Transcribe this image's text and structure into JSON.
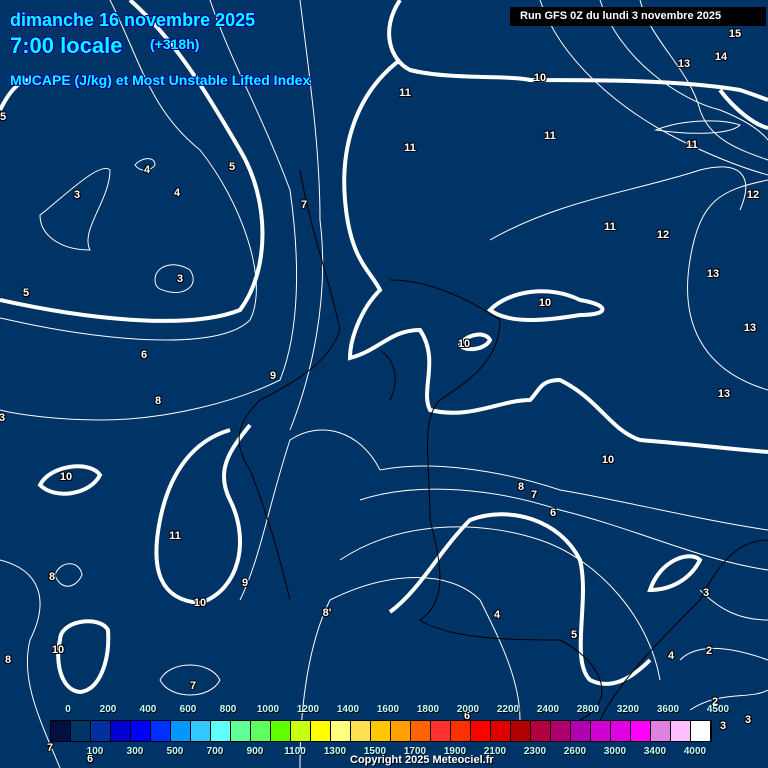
{
  "header": {
    "date": "dimanche 16 novembre 2025",
    "hour": "7:00 locale",
    "lead": "(+318h)",
    "parameter": "MUCAPE (J/kg) et Most Unstable Lifted Index",
    "run": "Run GFS 0Z du lundi 3 novembre 2025"
  },
  "contour_labels": [
    "11",
    "10",
    "15",
    "14",
    "13",
    "11",
    "11",
    "11",
    "5",
    "4",
    "4",
    "5",
    "3",
    "7",
    "12",
    "11",
    "12",
    "3",
    "5",
    "13",
    "10",
    "13",
    "10",
    "6",
    "9",
    "8",
    "3",
    "13",
    "10",
    "10",
    "8",
    "7",
    "6",
    "11",
    "8",
    "9",
    "10",
    "8'",
    "4",
    "3",
    "5",
    "10",
    "8",
    "4",
    "2",
    "7",
    "2",
    "3",
    "3",
    "6",
    "7",
    "6"
  ],
  "legend": {
    "colors": [
      "#001040",
      "#003366",
      "#0030a0",
      "#0000d0",
      "#0000ff",
      "#0030ff",
      "#0098ff",
      "#30c8ff",
      "#60ffff",
      "#60ff98",
      "#60ff60",
      "#60ff00",
      "#c8ff10",
      "#ffff00",
      "#ffff80",
      "#ffe050",
      "#ffc800",
      "#ffa000",
      "#ff6400",
      "#ff3030",
      "#ff3000",
      "#ff0000",
      "#e00000",
      "#b00000",
      "#b00040",
      "#b00070",
      "#b000b0",
      "#d000d0",
      "#e000e0",
      "#ff00ff",
      "#e080e0",
      "#ffc0ff",
      "#ffffff"
    ],
    "top_labels": [
      "0",
      "200",
      "400",
      "600",
      "800",
      "1000",
      "1200",
      "1400",
      "1600",
      "1800",
      "2000",
      "2200",
      "2400",
      "2800",
      "3200",
      "3600",
      "4500"
    ],
    "bottom_labels": [
      "100",
      "300",
      "500",
      "700",
      "900",
      "1100",
      "1300",
      "1500",
      "1700",
      "1900",
      "2100",
      "2300",
      "2600",
      "3000",
      "3400",
      "4000"
    ]
  },
  "copyright": "Copyright 2025 Meteociel.fr"
}
